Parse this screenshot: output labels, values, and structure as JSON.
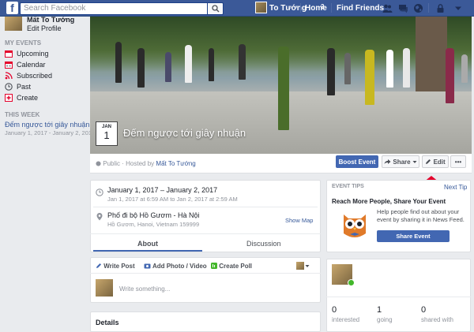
{
  "topbar": {
    "logo": "f",
    "search_placeholder": "Search Facebook",
    "user_name": "To Tướng",
    "home_label": "Home",
    "home_count": "2",
    "find_friends": "Find Friends"
  },
  "left": {
    "profile_name": "Mất To Tướng",
    "edit_profile": "Edit Profile",
    "my_events_header": "MY EVENTS",
    "items": [
      {
        "label": "Upcoming",
        "icon": "calendar-icon"
      },
      {
        "label": "Calendar",
        "icon": "calendar-grid-icon"
      },
      {
        "label": "Subscribed",
        "icon": "rss-icon"
      },
      {
        "label": "Past",
        "icon": "clock-icon"
      },
      {
        "label": "Create",
        "icon": "plus-icon"
      }
    ],
    "this_week_header": "THIS WEEK",
    "this_week_event": "Đếm ngược tới giây nhuận",
    "this_week_date": "January 1, 2017 - January 2, 2017"
  },
  "event": {
    "month": "JAN",
    "day": "1",
    "title": "Đếm ngược tới giây nhuận",
    "privacy": "Public",
    "hosted_prefix": "· Hosted by",
    "host": "Mất To Tướng",
    "boost": "Boost Event",
    "share": "Share",
    "edit": "Edit",
    "more": "•••"
  },
  "info": {
    "date_main": "January 1, 2017 – January 2, 2017",
    "date_sub": "Jan 1, 2017 at 6:59 AM to Jan 2, 2017 at 2:59 AM",
    "place_main": "Phố đi bộ Hồ Gươm - Hà Nội",
    "place_sub": "Hồ Gươm, Hanoi, Vietnam 159999",
    "show_map": "Show Map",
    "tab_about": "About",
    "tab_discussion": "Discussion"
  },
  "composer": {
    "write_post": "Write Post",
    "add_photo": "Add Photo / Video",
    "create_poll": "Create Poll",
    "placeholder": "Write something..."
  },
  "details": {
    "title": "Details"
  },
  "tips": {
    "header": "EVENT TIPS",
    "next": "Next Tip",
    "title": "Reach More People, Share Your Event",
    "body": "Help people find out about your event by sharing it in News Feed.",
    "button": "Share Event"
  },
  "stats": [
    {
      "num": "0",
      "label": "interested"
    },
    {
      "num": "1",
      "label": "going"
    },
    {
      "num": "0",
      "label": "shared with"
    }
  ],
  "colors": {
    "brand": "#3b5998",
    "button": "#4267b2",
    "arrow": "#e4002b"
  }
}
